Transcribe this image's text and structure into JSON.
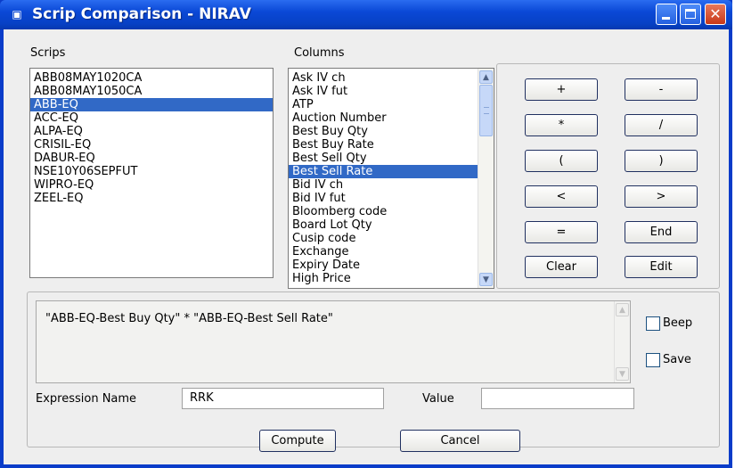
{
  "window": {
    "title": "Scrip Comparison - NIRAV",
    "icon": "app-icon",
    "controls": [
      "minimize-icon",
      "maximize-icon",
      "close-icon"
    ]
  },
  "scrips": {
    "label": "Scrips",
    "items": [
      "ABB08MAY1020CA",
      "ABB08MAY1050CA",
      "ABB-EQ",
      "ACC-EQ",
      "ALPA-EQ",
      "CRISIL-EQ",
      "DABUR-EQ",
      "NSE10Y06SEPFUT",
      "WIPRO-EQ",
      "ZEEL-EQ"
    ],
    "selected": "ABB-EQ"
  },
  "columns": {
    "label": "Columns",
    "items": [
      "Ask IV ch",
      "Ask IV fut",
      "ATP",
      "Auction Number",
      "Best Buy Qty",
      "Best Buy Rate",
      "Best Sell Qty",
      "Best Sell Rate",
      "Bid IV ch",
      "Bid IV fut",
      "Bloomberg code",
      "Board Lot Qty",
      "Cusip code",
      "Exchange",
      "Expiry Date",
      "High Price"
    ],
    "selected": "Best Sell Rate"
  },
  "operators": {
    "plus": "+",
    "minus": "-",
    "multiply": "*",
    "divide": "/",
    "open_paren": "(",
    "close_paren": ")",
    "less_than": "<",
    "greater_than": ">",
    "equals": "=",
    "end": "End",
    "clear": "Clear",
    "edit": "Edit"
  },
  "expression": {
    "text": "\"ABB-EQ-Best Buy Qty\" * \"ABB-EQ-Best Sell Rate\""
  },
  "options": {
    "beep_label": "Beep",
    "save_label": "Save"
  },
  "form": {
    "expression_name_label": "Expression Name",
    "expression_name_value": "RRK",
    "value_label": "Value",
    "value_value": ""
  },
  "footer": {
    "compute_label": "Compute",
    "cancel_label": "Cancel"
  }
}
